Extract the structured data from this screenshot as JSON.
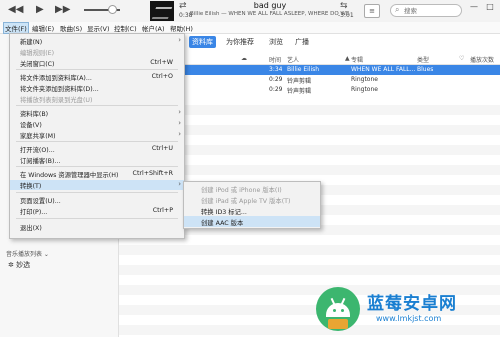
{
  "player": {
    "controls": {
      "prev": "◀◀",
      "play": "▶",
      "next": "▶▶"
    },
    "volume_level": 0.7,
    "shuffle_glyph": "⇄",
    "repeat_glyph": "⇆",
    "elapsed": "0:38",
    "remaining": "-3:01",
    "song_title": "bad guy",
    "song_subtitle": "Billie Eilish — WHEN WE ALL FALL ASLEEP, WHERE DO WE GO?",
    "list_glyph": "≡",
    "search_icon": "⌕",
    "search_placeholder": "搜索",
    "window_buttons": {
      "minimize": "—",
      "restore": "□"
    }
  },
  "menubar": [
    "文件(F)",
    "编辑(E)",
    "歌曲(S)",
    "显示(V)",
    "控制(C)",
    "帐户(A)",
    "帮助(H)"
  ],
  "file_menu": {
    "items": [
      {
        "label": "新建(N)",
        "shortcut": "",
        "arrow": "›",
        "disabled": false
      },
      {
        "label": "编辑规则(E)",
        "shortcut": "",
        "arrow": "",
        "disabled": true
      },
      {
        "label": "关闭窗口(C)",
        "shortcut": "Ctrl+W",
        "arrow": "",
        "disabled": false
      },
      {
        "label": "将文件添加到资料库(A)...",
        "shortcut": "Ctrl+O",
        "arrow": "",
        "disabled": false
      },
      {
        "label": "将文件夹添加到资料库(D)...",
        "shortcut": "",
        "arrow": "",
        "disabled": false
      },
      {
        "label": "将播放列表刻录到光盘(U)",
        "shortcut": "",
        "arrow": "",
        "disabled": true
      },
      {
        "label": "资料库(B)",
        "shortcut": "",
        "arrow": "›",
        "disabled": false
      },
      {
        "label": "设备(V)",
        "shortcut": "",
        "arrow": "›",
        "disabled": false
      },
      {
        "label": "家庭共享(M)",
        "shortcut": "",
        "arrow": "›",
        "disabled": false
      },
      {
        "label": "打开流(O)...",
        "shortcut": "Ctrl+U",
        "arrow": "",
        "disabled": false
      },
      {
        "label": "订阅播客(B)...",
        "shortcut": "",
        "arrow": "",
        "disabled": false
      },
      {
        "label": "在 Windows 资源管理器中显示(H)",
        "shortcut": "Ctrl+Shift+R",
        "arrow": "",
        "disabled": false
      },
      {
        "label": "转换(T)",
        "shortcut": "",
        "arrow": "›",
        "disabled": false
      },
      {
        "label": "页面设置(U)...",
        "shortcut": "",
        "arrow": "",
        "disabled": false
      },
      {
        "label": "打印(P)...",
        "shortcut": "Ctrl+P",
        "arrow": "",
        "disabled": false
      },
      {
        "label": "退出(X)",
        "shortcut": "",
        "arrow": "",
        "disabled": false
      }
    ]
  },
  "convert_submenu": [
    {
      "label": "创建 iPod 或 iPhone 版本(I)",
      "disabled": true
    },
    {
      "label": "创建 iPad 或 Apple TV 版本(T)",
      "disabled": true
    },
    {
      "label": "转换 ID3 标记...",
      "disabled": false
    },
    {
      "label": "创建 AAC 版本",
      "disabled": false
    }
  ],
  "tabs": [
    "资料库",
    "为你推荐",
    "浏览",
    "广播"
  ],
  "columns": {
    "cloud_icon": "☁",
    "time": "时间",
    "artist": "艺人",
    "sort": "▲",
    "album": "专辑",
    "genre": "类型",
    "heart_icon": "♡",
    "plays": "播放次数"
  },
  "songs": [
    {
      "time": "3:34",
      "artist": "Billie Eilish",
      "album": "WHEN WE ALL FALL...",
      "genre": "Blues",
      "selected": true
    },
    {
      "time": "0:29",
      "artist": "铃声剪辑",
      "album": "Ringtone",
      "genre": "",
      "selected": false
    },
    {
      "time": "0:29",
      "artist": "铃声剪辑",
      "album": "Ringtone",
      "genre": "",
      "selected": false
    }
  ],
  "sidebar": {
    "playlists_heading": "音乐播放列表 ⌄",
    "playlist_item": "✲ 妙选"
  },
  "watermark": {
    "brand": "蓝莓安卓网",
    "url": "www.lmkjst.com"
  },
  "colors": {
    "accent": "#3a86e6",
    "brand": "#1a7fd1",
    "logo": "#3cb66f"
  }
}
